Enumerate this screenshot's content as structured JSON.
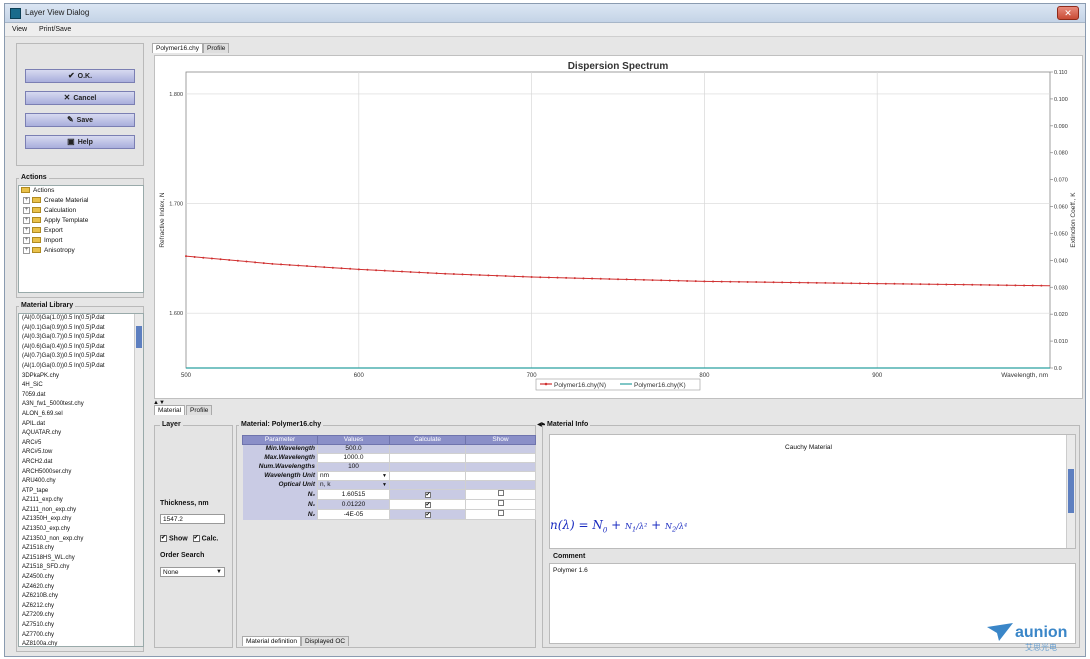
{
  "window": {
    "title": "Layer View Dialog"
  },
  "menu": {
    "items": [
      "View",
      "Print/Save"
    ]
  },
  "buttons": {
    "ok": "O.K.",
    "cancel": "Cancel",
    "save": "Save",
    "help": "Help"
  },
  "actions": {
    "label": "Actions",
    "root": "Actions",
    "items": [
      "Create Material",
      "Calculation",
      "Apply Template",
      "Export",
      "Import",
      "Anisotropy"
    ]
  },
  "library": {
    "label": "Material Library",
    "items": [
      "(Al(0.0)Ga(1.0))0.5 In(0.5)P.dat",
      "(Al(0.1)Ga(0.9))0.5 In(0.5)P.dat",
      "(Al(0.3)Ga(0.7))0.5 In(0.5)P.dat",
      "(Al(0.6)Ga(0.4))0.5 In(0.5)P.dat",
      "(Al(0.7)Ga(0.3))0.5 In(0.5)P.dat",
      "(Al(1.0)Ga(0.0))0.5 In(0.5)P.dat",
      "3DPkaPK.chy",
      "4H_SiC",
      "7059.dat",
      "A3N_fw1_5000test.chy",
      "ALON_6.69.sel",
      "APIL.dat",
      "AQUATAR.chy",
      "ARC#5",
      "ARC#5.tow",
      "ARCH2.dat",
      "ARCH5000ser.chy",
      "ARU400.chy",
      "ATP_tape",
      "AZ111_exp.chy",
      "AZ111_non_exp.chy",
      "AZ1350H_exp.chy",
      "AZ1350J_exp.chy",
      "AZ1350J_non_exp.chy",
      "AZ1518.chy",
      "AZ1518HS_WL.chy",
      "AZ1518_SFD.chy",
      "AZ4500.chy",
      "AZ4620.chy",
      "AZ6210B.chy",
      "AZ6212.chy",
      "AZ7209.chy",
      "AZ7510.chy",
      "AZ7700.chy",
      "AZ8100a.chy"
    ]
  },
  "top_tabs": [
    "Polymer16.chy",
    "Profile"
  ],
  "chart_data": {
    "type": "line",
    "title": "Dispersion Spectrum",
    "xlabel": "Wavelength, nm",
    "ylabel": "Refractive Index, N",
    "y2label": "Extinction Coeff., K",
    "xlim": [
      500,
      1000
    ],
    "ylim": [
      1.55,
      1.82
    ],
    "y2lim": [
      0.0,
      0.11
    ],
    "x_ticks": [
      500,
      600,
      700,
      800,
      900
    ],
    "y_ticks": [
      "1.800",
      "1.700",
      "1.600",
      "1.500"
    ],
    "y_tick_values": [
      1.8,
      1.7,
      1.6,
      1.5
    ],
    "y2_ticks": [
      "0.110",
      "0.100",
      "0.090",
      "0.080",
      "0.070",
      "0.060",
      "0.050",
      "0.040",
      "0.030",
      "0.020",
      "0.010",
      "0.0"
    ],
    "y2_tick_values": [
      0.11,
      0.1,
      0.09,
      0.08,
      0.07,
      0.06,
      0.05,
      0.04,
      0.03,
      0.02,
      0.01,
      0.0
    ],
    "grid": true,
    "legend_position": "bottom-center",
    "series": [
      {
        "name": "Polymer16.chy(N)",
        "color": "#d03030",
        "x": [
          500,
          550,
          600,
          650,
          700,
          750,
          800,
          850,
          900,
          950,
          1000
        ],
        "values": [
          1.652,
          1.645,
          1.64,
          1.636,
          1.633,
          1.631,
          1.629,
          1.628,
          1.627,
          1.626,
          1.625
        ]
      },
      {
        "name": "Polymer16.chy(K)",
        "color": "#2aa0a0",
        "x": [
          500,
          1000
        ],
        "values": [
          0.0,
          0.0
        ]
      }
    ]
  },
  "bottom_tabs": [
    "Material",
    "Profile"
  ],
  "layer": {
    "label": "Layer",
    "thickness_label": "Thickness, nm",
    "thickness_value": "1547.2",
    "show_label": "Show",
    "calc_label": "Calc.",
    "order_label": "Order Search",
    "order_value": "None"
  },
  "material": {
    "label": "Material: Polymer16.chy",
    "headers": [
      "Parameter",
      "Values",
      "Calculate",
      "Show"
    ],
    "rows": [
      {
        "name": "Min.Wavelength",
        "value": "500.0"
      },
      {
        "name": "Max.Wavelength",
        "value": "1000.0"
      },
      {
        "name": "Num.Wavelengths",
        "value": "100"
      },
      {
        "name": "Wavelength Unit",
        "value": "nm"
      },
      {
        "name": "Optical Unit",
        "value": "n, k"
      },
      {
        "name": "N₀",
        "value": "1.60515",
        "calc": true,
        "show": false
      },
      {
        "name": "N₁",
        "value": "0.01220",
        "calc": true,
        "show": false
      },
      {
        "name": "N₂",
        "value": "-4E-05",
        "calc": true,
        "show": false
      }
    ],
    "subtabs": [
      "Material definition",
      "Displayed OC"
    ]
  },
  "info": {
    "label": "Material Info",
    "type": "Cauchy Material",
    "comment_label": "Comment",
    "comment_text": "Polymer 1.6"
  },
  "watermark": {
    "text": "aunion",
    "subtext": "艾思光电"
  }
}
